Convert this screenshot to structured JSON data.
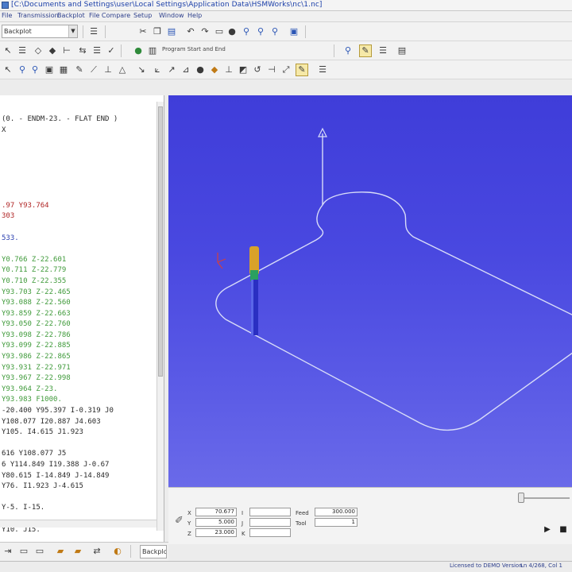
{
  "window": {
    "title": "[C:\\Documents and Settings\\user\\Local Settings\\Application Data\\HSMWorks\\nc\\1.nc]"
  },
  "menu": [
    "File",
    "Transmission",
    "Backplot",
    "File Compare",
    "Setup",
    "Window",
    "Help"
  ],
  "toolbar": {
    "mode_combo": "Backplot",
    "program_start_label": "Program Start and End"
  },
  "code_lines": [
    {
      "text": "(0. - ENDM-23. - FLAT END )",
      "color": "black"
    },
    {
      "text": "X",
      "color": "black"
    },
    {
      "text": "",
      "color": "black"
    },
    {
      "text": "",
      "color": "black"
    },
    {
      "text": "",
      "color": "black"
    },
    {
      "text": "",
      "color": "black"
    },
    {
      "text": "",
      "color": "black"
    },
    {
      "text": "",
      "color": "black"
    },
    {
      "text": ".97 Y93.764",
      "color": "red"
    },
    {
      "text": "303",
      "color": "red"
    },
    {
      "text": "",
      "color": "black"
    },
    {
      "text": "533.",
      "color": "blue"
    },
    {
      "text": "",
      "color": "black"
    },
    {
      "text": "Y0.766 Z-22.601",
      "color": "green"
    },
    {
      "text": "Y0.711 Z-22.779",
      "color": "green"
    },
    {
      "text": "Y0.710 Z-22.355",
      "color": "green"
    },
    {
      "text": "Y93.703 Z-22.465",
      "color": "green"
    },
    {
      "text": "Y93.088 Z-22.560",
      "color": "green"
    },
    {
      "text": "Y93.859 Z-22.663",
      "color": "green"
    },
    {
      "text": "Y93.050 Z-22.760",
      "color": "green"
    },
    {
      "text": "Y93.098 Z-22.786",
      "color": "green"
    },
    {
      "text": "Y93.099 Z-22.885",
      "color": "green"
    },
    {
      "text": "Y93.986 Z-22.865",
      "color": "green"
    },
    {
      "text": "Y93.931 Z-22.971",
      "color": "green"
    },
    {
      "text": "Y93.967 Z-22.998",
      "color": "green"
    },
    {
      "text": "Y93.964 Z-23.",
      "color": "green"
    },
    {
      "text": "Y93.983 F1000.",
      "color": "green"
    },
    {
      "text": "-20.400 Y95.397 I-0.319 J0",
      "color": "black"
    },
    {
      "text": " Y108.077 I20.887 J4.603",
      "color": "black"
    },
    {
      "text": " Y105. I4.615 J1.923",
      "color": "black"
    },
    {
      "text": "",
      "color": "black"
    },
    {
      "text": " 616 Y108.077 J5",
      "color": "black"
    },
    {
      "text": "6 Y114.849 I19.388 J-0.67",
      "color": "black"
    },
    {
      "text": "Y80.615 I-14.849 J-14.849",
      "color": "black"
    },
    {
      "text": " Y76. I1.923 J-4.615",
      "color": "black"
    },
    {
      "text": "",
      "color": "black"
    },
    {
      "text": " Y-5. I-15.",
      "color": "black"
    },
    {
      "text": "",
      "color": "black"
    },
    {
      "text": "Y10. J15.",
      "color": "black"
    }
  ],
  "readout": {
    "x_label": "X",
    "x_value": "70.677",
    "y_label": "Y",
    "y_value": "5.000",
    "z_label": "Z",
    "z_value": "23.000",
    "i_label": "I",
    "j_label": "J",
    "k_label": "K",
    "i_value": "",
    "j_value": "",
    "k_value": "",
    "feed_label": "Feed",
    "feed_value": "300.000",
    "tool_label": "Tool",
    "tool_value": "1"
  },
  "left_bottom": {
    "combo": "Backplot"
  },
  "status": {
    "left": "Licensed to DEMO Version",
    "right": "Ln 4/268, Col 1"
  },
  "colors": {
    "viewport_bg": "#4646dc",
    "toolpath": "#d8dcf8",
    "tool_body": "#2a2fc2",
    "tool_tip": "#d9a22a",
    "code_green": "#3f9a3a",
    "code_red": "#b02525"
  }
}
